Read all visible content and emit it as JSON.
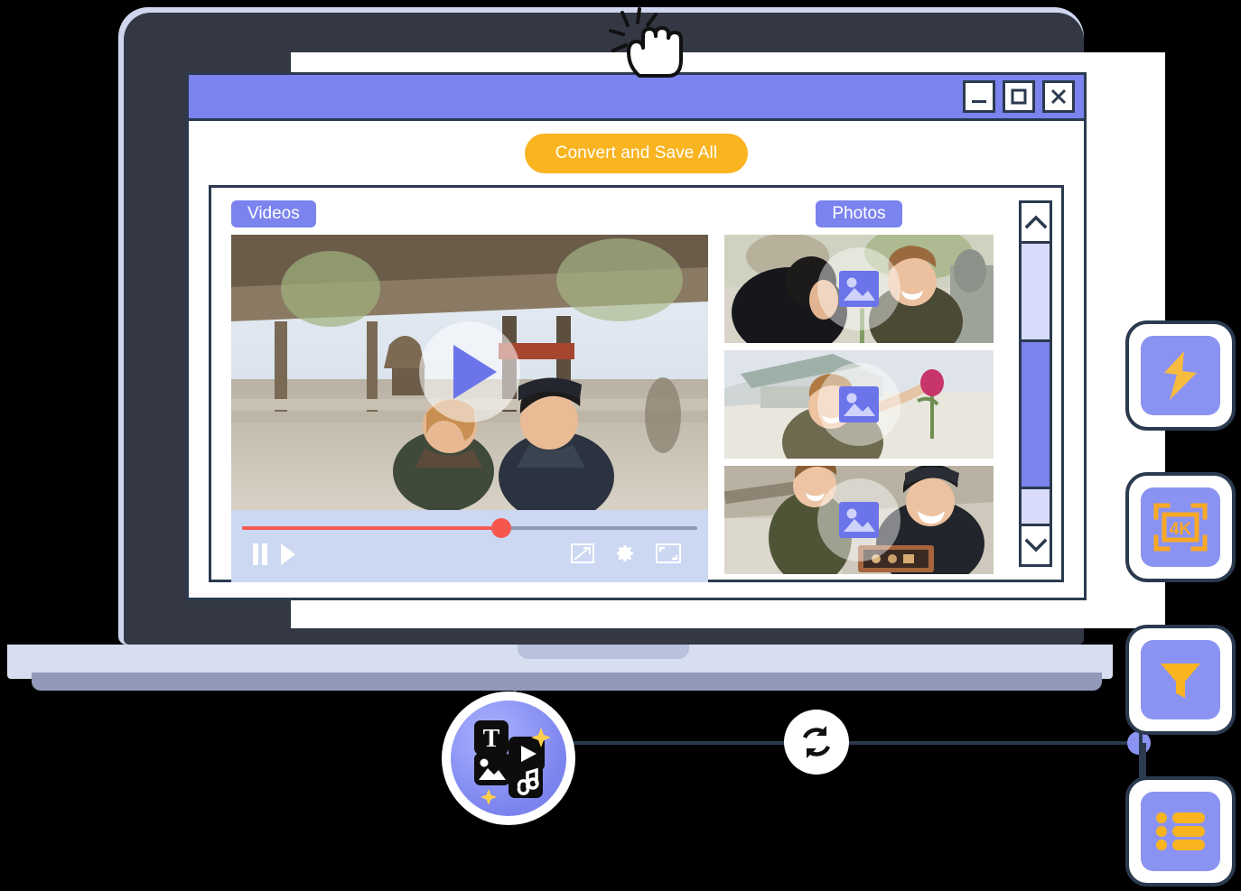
{
  "window": {
    "titlebar": {
      "minimize_label": "Minimize",
      "maximize_label": "Maximize",
      "close_label": "Close"
    }
  },
  "toolbar": {
    "convert_button": "Convert and Save All",
    "cursor_icon": "hand-pointer-icon"
  },
  "panels": {
    "videos": {
      "label": "Videos",
      "play_icon": "play-icon",
      "controls": {
        "pause_icon": "pause-icon",
        "play_icon": "play-icon",
        "pip_icon": "picture-in-picture-icon",
        "settings_icon": "gear-icon",
        "fullscreen_icon": "fullscreen-icon"
      },
      "progress_percent": 57
    },
    "photos": {
      "label": "Photos",
      "items": [
        {
          "overlay_icon": "image-placeholder-icon"
        },
        {
          "overlay_icon": "image-placeholder-icon"
        },
        {
          "overlay_icon": "image-placeholder-icon"
        }
      ]
    },
    "scrollbar": {
      "up_icon": "chevron-up-icon",
      "down_icon": "chevron-down-icon",
      "thumb_label": "Scroll thumb"
    }
  },
  "features": [
    {
      "id": "speed",
      "icon": "lightning-bolt-icon",
      "label": "Fast conversion"
    },
    {
      "id": "resolution",
      "icon": "4k-icon",
      "label": "4K"
    },
    {
      "id": "filter",
      "icon": "filter-funnel-icon",
      "label": "Filter"
    },
    {
      "id": "list",
      "icon": "bulleted-list-icon",
      "label": "Batch list"
    }
  ],
  "badges": {
    "media_badge": {
      "icon": "media-convert-icon",
      "tiles": [
        "text-tile",
        "video-tile",
        "image-tile",
        "music-tile"
      ]
    },
    "refresh_badge": {
      "icon": "convert-refresh-icon"
    }
  },
  "colors": {
    "accent_purple": "#7b83ee",
    "accent_yellow": "#f9b420",
    "outline_navy": "#2b3a4f",
    "progress_red": "#f5574f",
    "laptop_body": "#343844",
    "laptop_base": "#d6deef"
  }
}
